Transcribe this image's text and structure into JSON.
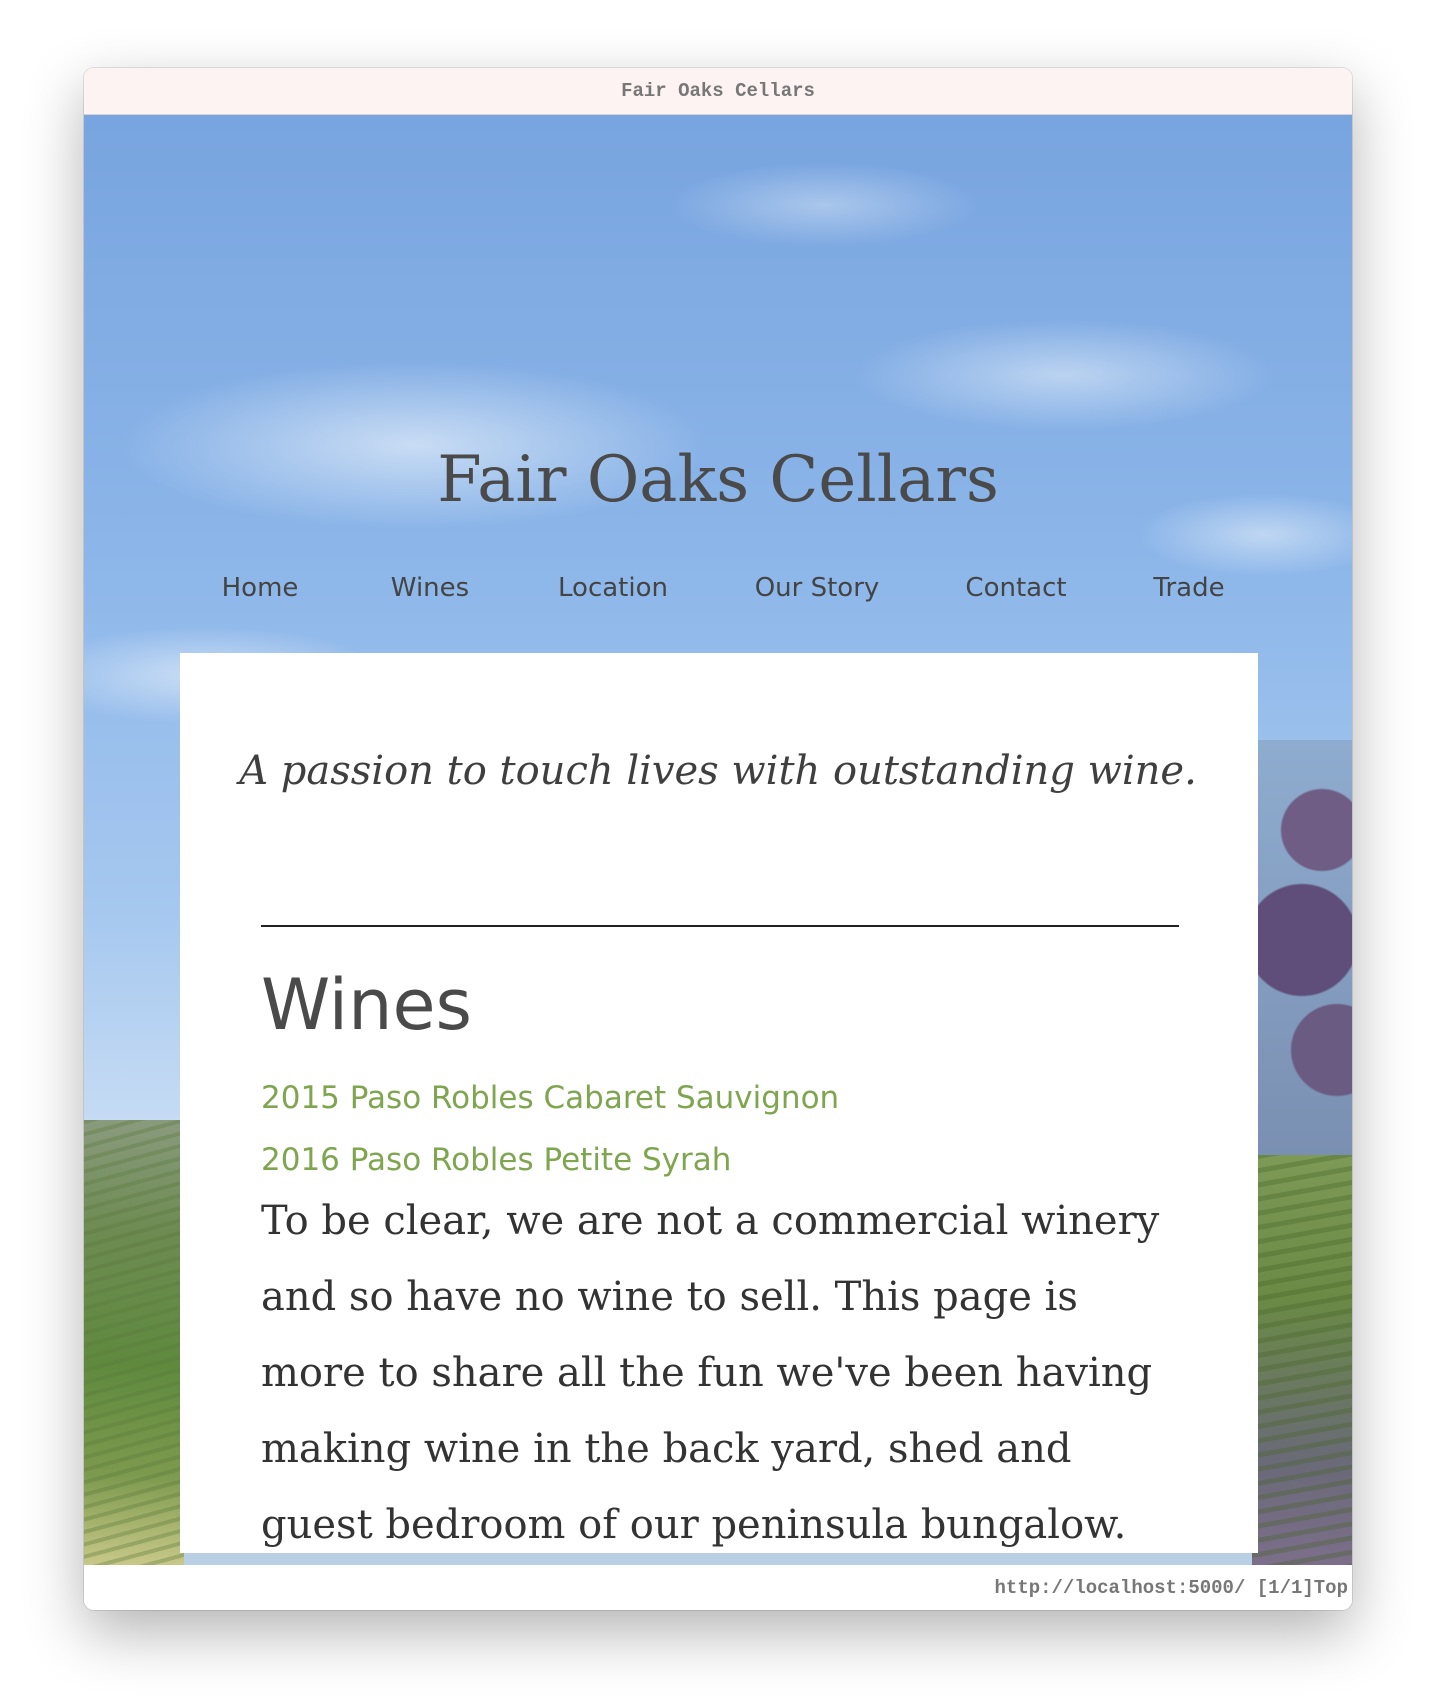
{
  "window": {
    "title": "Fair Oaks Cellars"
  },
  "site": {
    "title": "Fair Oaks Cellars",
    "nav": [
      "Home",
      "Wines",
      "Location",
      "Our Story",
      "Contact",
      "Trade"
    ],
    "tagline": "A passion to touch lives with outstanding wine."
  },
  "section": {
    "heading": "Wines",
    "wines": [
      "2015 Paso Robles Cabaret Sauvignon",
      "2016 Paso Robles Petite Syrah"
    ],
    "body": "To be clear, we are not a commercial winery and so have no wine to sell. This page is more to share all the fun we've been having making wine in the back yard, shed and guest bedroom of our peninsula bungalow."
  },
  "status": {
    "url": "http://localhost:5000/",
    "page": "[1/1]",
    "position": "Top"
  },
  "colors": {
    "link": "#7fa54f",
    "text": "#333333",
    "titlebar": "#fdf3f2"
  }
}
